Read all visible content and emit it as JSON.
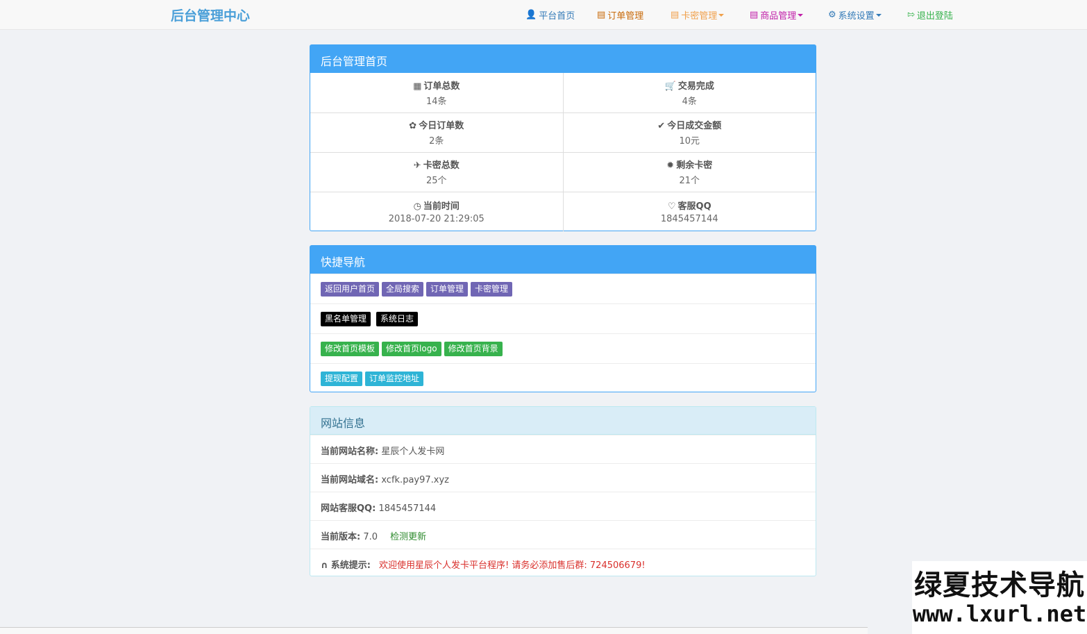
{
  "navbar": {
    "brand": "后台管理中心",
    "items": [
      {
        "label": "平台首页",
        "icon": "user-icon",
        "color": "#337ab7",
        "dropdown": false
      },
      {
        "label": "订单管理",
        "icon": "list-icon",
        "color": "#c86a0a",
        "dropdown": false
      },
      {
        "label": "卡密管理",
        "icon": "document-icon",
        "color": "#f0a04b",
        "dropdown": true
      },
      {
        "label": "商品管理",
        "icon": "book-icon",
        "color": "#c020a8",
        "dropdown": true
      },
      {
        "label": "系统设置",
        "icon": "gear-icon",
        "color": "#337ab7",
        "dropdown": true
      },
      {
        "label": "退出登陆",
        "icon": "logout-icon",
        "color": "#37b24d",
        "dropdown": false
      }
    ]
  },
  "dashboard": {
    "title": "后台管理首页",
    "stats": [
      {
        "label": "订单总数",
        "value": "14条",
        "icon": "grid-icon"
      },
      {
        "label": "交易完成",
        "value": "4条",
        "icon": "cart-icon"
      },
      {
        "label": "今日订单数",
        "value": "2条",
        "icon": "leaf-icon"
      },
      {
        "label": "今日成交金额",
        "value": "10元",
        "icon": "check-icon"
      },
      {
        "label": "卡密总数",
        "value": "25个",
        "icon": "plane-icon"
      },
      {
        "label": "剩余卡密",
        "value": "21个",
        "icon": "certificate-icon"
      },
      {
        "label": "当前时间",
        "value": "2018-07-20 21:29:05",
        "icon": "clock-icon"
      },
      {
        "label": "客服QQ",
        "value": "1845457144",
        "icon": "heart-icon"
      }
    ]
  },
  "quicknav": {
    "title": "快捷导航",
    "rows": [
      {
        "style": "purple",
        "items": [
          "返回用户首页",
          "全局搜索",
          "订单管理",
          "卡密管理"
        ]
      },
      {
        "style": "black",
        "items": [
          "黑名单管理",
          "系统日志"
        ]
      },
      {
        "style": "green",
        "items": [
          "修改首页模板",
          "修改首页logo",
          "修改首页背景"
        ]
      },
      {
        "style": "cyan",
        "items": [
          "提现配置",
          "订单监控地址"
        ]
      }
    ]
  },
  "siteinfo": {
    "title": "网站信息",
    "name_label": "当前网站名称:",
    "name_value": "星辰个人发卡网",
    "domain_label": "当前网站域名:",
    "domain_value": "xcfk.pay97.xyz",
    "qq_label": "网站客服QQ:",
    "qq_value": "1845457144",
    "version_label": "当前版本:",
    "version_value": "7.0",
    "update_link": "检测更新",
    "notice_label": "系统提示:",
    "notice_text": "欢迎使用星辰个人发卡平台程序! 请务必添加售后群: 724506679!"
  },
  "watermark": {
    "line1": "绿夏技术导航",
    "line2": "www.lxurl.net"
  }
}
